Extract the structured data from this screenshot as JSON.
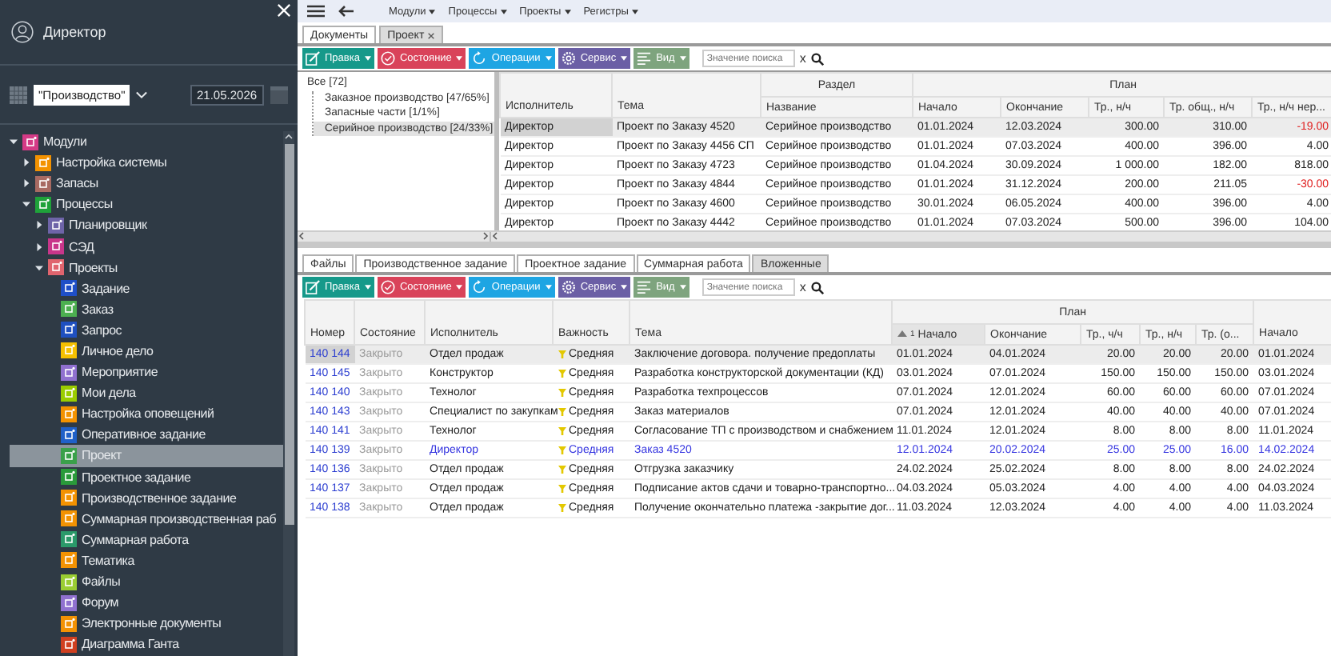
{
  "sidebar": {
    "user": "Директор",
    "org_select": "\"Производство\"",
    "date": "21.05.2026",
    "tree": [
      {
        "label": "Модули",
        "kind": "folder",
        "color": "#d43a86",
        "expanded": true,
        "selected": false,
        "children": [
          {
            "label": "Настройка системы",
            "kind": "folder",
            "color": "#f39200",
            "expanded": false,
            "selected": false
          },
          {
            "label": "Запасы",
            "kind": "folder",
            "color": "#a86a62",
            "expanded": false,
            "selected": false
          },
          {
            "label": "Процессы",
            "kind": "folder",
            "color": "#1fa23a",
            "expanded": true,
            "selected": false,
            "children": [
              {
                "label": "Планировщик",
                "kind": "folder",
                "color": "#6e64a8",
                "expanded": false,
                "selected": false
              },
              {
                "label": "СЭД",
                "kind": "folder",
                "color": "#c8368a",
                "expanded": false,
                "selected": false
              },
              {
                "label": "Проекты",
                "kind": "folder",
                "color": "#e0646e",
                "expanded": true,
                "selected": false,
                "children": [
                  {
                    "label": "Задание",
                    "kind": "module",
                    "color": "#1f4fc8",
                    "selected": false
                  },
                  {
                    "label": "Заказ",
                    "kind": "module",
                    "color": "#4caf50",
                    "selected": false
                  },
                  {
                    "label": "Запрос",
                    "kind": "module",
                    "color": "#1f50c0",
                    "selected": false
                  },
                  {
                    "label": "Личное дело",
                    "kind": "module",
                    "color": "#f5c000",
                    "selected": false
                  },
                  {
                    "label": "Мероприятие",
                    "kind": "module",
                    "color": "#9070d0",
                    "selected": false
                  },
                  {
                    "label": "Мои дела",
                    "kind": "module",
                    "color": "#9acd00",
                    "selected": false
                  },
                  {
                    "label": "Настройка оповещений",
                    "kind": "module",
                    "color": "#f39200",
                    "selected": false
                  },
                  {
                    "label": "Оперативное задание",
                    "kind": "module",
                    "color": "#1f60c8",
                    "selected": false
                  },
                  {
                    "label": "Проект",
                    "kind": "module",
                    "color": "#3aa04a",
                    "selected": true
                  },
                  {
                    "label": "Проектное задание",
                    "kind": "module",
                    "color": "#2a9a3a",
                    "selected": false
                  },
                  {
                    "label": "Производственное задание",
                    "kind": "module",
                    "color": "#f39201",
                    "selected": false
                  },
                  {
                    "label": "Суммарная производственная раб",
                    "kind": "module",
                    "color": "#f39202",
                    "selected": false
                  },
                  {
                    "label": "Суммарная работа",
                    "kind": "module",
                    "color": "#2a9a6a",
                    "selected": false
                  },
                  {
                    "label": "Тематика",
                    "kind": "module",
                    "color": "#f39203",
                    "selected": false
                  },
                  {
                    "label": "Файлы",
                    "kind": "module",
                    "color": "#9acd32",
                    "selected": false
                  },
                  {
                    "label": "Форум",
                    "kind": "module",
                    "color": "#9071d0",
                    "selected": false
                  },
                  {
                    "label": "Электронные документы",
                    "kind": "module",
                    "color": "#f39204",
                    "selected": false
                  },
                  {
                    "label": "Диаграмма Ганта",
                    "kind": "module",
                    "color": "#d04020",
                    "selected": false
                  }
                ]
              }
            ]
          }
        ]
      }
    ]
  },
  "menu": [
    "Модули",
    "Процессы",
    "Проекты",
    "Регистры"
  ],
  "doc_tabs": [
    {
      "label": "Документы",
      "selected": false,
      "closable": false
    },
    {
      "label": "Проект",
      "selected": true,
      "closable": true
    }
  ],
  "toolbar": {
    "buttons": [
      {
        "label": "Правка",
        "color": "#16998a"
      },
      {
        "label": "Состояние",
        "color": "#d9435a"
      },
      {
        "label": "Операции",
        "color": "#1ea5e3"
      },
      {
        "label": "Сервис",
        "color": "#6b5fa5"
      },
      {
        "label": "Вид",
        "color": "#7ea47e"
      }
    ],
    "search": {
      "placeholder": "Значение поиска",
      "clear": "x"
    }
  },
  "filter_tree": {
    "label": "Все [72]",
    "selected": false,
    "children": [
      {
        "label": "Заказное производство [47/65%]",
        "selected": false
      },
      {
        "label": "Запасные части [1/1%]",
        "selected": false
      },
      {
        "label": "Серийное производство [24/33%]",
        "selected": true
      }
    ]
  },
  "upper_table": {
    "groups": [
      {
        "columns": [
          {
            "label": "Исполнитель"
          }
        ]
      },
      {
        "columns": [
          {
            "label": "Тема"
          }
        ]
      },
      {
        "title": "Раздел",
        "columns": [
          {
            "label": "Название"
          }
        ]
      },
      {
        "title": "План",
        "columns": [
          {
            "label": "Начало"
          },
          {
            "label": "Окончание"
          },
          {
            "label": "Тр., н/ч"
          },
          {
            "label": "Тр. общ., н/ч"
          },
          {
            "label": "Тр., н/ч нер..."
          }
        ]
      }
    ],
    "rows": [
      {
        "cells": [
          "Директор",
          "Проект по Заказу 4520",
          "Серийное производство",
          "01.01.2024",
          "12.03.2024",
          "300.00",
          "310.00",
          "-19.00"
        ],
        "selected": true,
        "deficit": true
      },
      {
        "cells": [
          "Директор",
          "Проект по Заказу 4456 СП",
          "Серийное производство",
          "01.01.2024",
          "07.03.2024",
          "400.00",
          "396.00",
          "4.00"
        ],
        "selected": false,
        "deficit": false
      },
      {
        "cells": [
          "Директор",
          "Проект по Заказу 4723",
          "Серийное производство",
          "01.04.2024",
          "30.09.2024",
          "1 000.00",
          "182.00",
          "818.00"
        ],
        "selected": false,
        "deficit": false
      },
      {
        "cells": [
          "Директор",
          "Проект по Заказу 4844",
          "Серийное производство",
          "01.01.2024",
          "31.12.2024",
          "200.00",
          "211.05",
          "-30.00"
        ],
        "selected": false,
        "deficit": true
      },
      {
        "cells": [
          "Директор",
          "Проект по Заказу 4600",
          "Серийное производство",
          "30.01.2024",
          "06.05.2024",
          "400.00",
          "396.00",
          "4.00"
        ],
        "selected": false,
        "deficit": false
      },
      {
        "cells": [
          "Директор",
          "Проект по Заказу 4442",
          "Серийное производство",
          "01.01.2024",
          "07.03.2024",
          "500.00",
          "396.00",
          "104.00"
        ],
        "selected": false,
        "deficit": false
      }
    ]
  },
  "detail_tabs": [
    {
      "label": "Файлы",
      "selected": false
    },
    {
      "label": "Производственное задание",
      "selected": false
    },
    {
      "label": "Проектное задание",
      "selected": false
    },
    {
      "label": "Суммарная работа",
      "selected": false
    },
    {
      "label": "Вложенные",
      "selected": true
    }
  ],
  "detail_toolbar": {
    "buttons": [
      {
        "label": "Правка",
        "color": "#16998a"
      },
      {
        "label": "Состояние",
        "color": "#d9435a"
      },
      {
        "label": "Операции",
        "color": "#1ea5e3"
      },
      {
        "label": "Сервис",
        "color": "#6b5fa5"
      },
      {
        "label": "Вид",
        "color": "#7ea47e"
      }
    ],
    "search": {
      "placeholder": "Значение поиска",
      "clear": "x"
    }
  },
  "lower_table": {
    "groups": [
      {
        "columns": [
          {
            "label": "Номер"
          }
        ]
      },
      {
        "columns": [
          {
            "label": "Состояние"
          }
        ]
      },
      {
        "columns": [
          {
            "label": "Исполнитель"
          }
        ]
      },
      {
        "columns": [
          {
            "label": "Важность"
          }
        ]
      },
      {
        "columns": [
          {
            "label": "Тема"
          }
        ]
      },
      {
        "title": "План",
        "columns": [
          {
            "label": "Начало",
            "sort_ascending": true,
            "sort_rank": "1"
          },
          {
            "label": "Окончание"
          },
          {
            "label": "Тр., ч/ч"
          },
          {
            "label": "Тр., н/ч"
          },
          {
            "label": "Тр. (о..."
          }
        ]
      },
      {
        "columns": [
          {
            "label": "Начало"
          }
        ]
      }
    ],
    "rows": [
      {
        "cells": [
          "140 144",
          "Закрыто",
          "Отдел продаж",
          "Средняя",
          "Заключение договора. получение предоплаты",
          "01.01.2024",
          "04.01.2024",
          "20.00",
          "20.00",
          "20.00",
          "01.01.2024"
        ],
        "selected": true,
        "highlight": false
      },
      {
        "cells": [
          "140 145",
          "Закрыто",
          "Конструктор",
          "Средняя",
          "Разработка конструкторской документации (КД)",
          "03.01.2024",
          "07.01.2024",
          "150.00",
          "150.00",
          "150.00",
          "03.01.2024"
        ],
        "selected": false,
        "highlight": false
      },
      {
        "cells": [
          "140 140",
          "Закрыто",
          "Технолог",
          "Средняя",
          "Разработка техпроцессов",
          "07.01.2024",
          "12.01.2024",
          "60.00",
          "60.00",
          "60.00",
          "07.01.2024"
        ],
        "selected": false,
        "highlight": false
      },
      {
        "cells": [
          "140 143",
          "Закрыто",
          "Специалист по закупкам",
          "Средняя",
          "Заказ материалов",
          "07.01.2024",
          "12.01.2024",
          "40.00",
          "40.00",
          "40.00",
          "07.01.2024"
        ],
        "selected": false,
        "highlight": false
      },
      {
        "cells": [
          "140 141",
          "Закрыто",
          "Технолог",
          "Средняя",
          "Согласование ТП с производством и снабжением",
          "11.01.2024",
          "12.01.2024",
          "8.00",
          "8.00",
          "8.00",
          "11.01.2024"
        ],
        "selected": false,
        "highlight": false
      },
      {
        "cells": [
          "140 139",
          "Закрыто",
          "Директор",
          "Средняя",
          "Заказ 4520",
          "12.01.2024",
          "20.02.2024",
          "25.00",
          "25.00",
          "16.00",
          "14.02.2024"
        ],
        "selected": false,
        "highlight": true
      },
      {
        "cells": [
          "140 136",
          "Закрыто",
          "Отдел продаж",
          "Средняя",
          "Отгрузка заказчику",
          "24.02.2024",
          "25.02.2024",
          "8.00",
          "8.00",
          "8.00",
          "24.02.2024"
        ],
        "selected": false,
        "highlight": false
      },
      {
        "cells": [
          "140 137",
          "Закрыто",
          "Отдел продаж",
          "Средняя",
          "Подписание актов сдачи и товарно-транспортно...",
          "04.03.2024",
          "05.03.2024",
          "4.00",
          "4.00",
          "4.00",
          "04.03.2024"
        ],
        "selected": false,
        "highlight": false
      },
      {
        "cells": [
          "140 138",
          "Закрыто",
          "Отдел продаж",
          "Средняя",
          "Получение окончательно платежа -закрытие дог...",
          "11.03.2024",
          "12.03.2024",
          "4.00",
          "4.00",
          "4.00",
          "11.03.2024"
        ],
        "selected": false,
        "highlight": false
      }
    ]
  }
}
